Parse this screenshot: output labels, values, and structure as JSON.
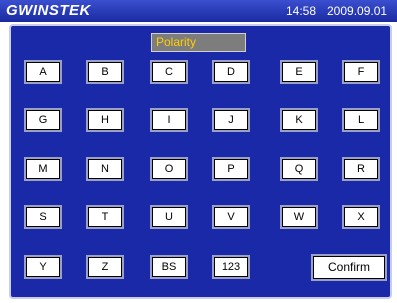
{
  "header": {
    "logo": "GWINSTEK",
    "time": "14:58",
    "date": "2009.09.01"
  },
  "input": {
    "value": "Polarity"
  },
  "keys": [
    "A",
    "B",
    "C",
    "D",
    "E",
    "F",
    "G",
    "H",
    "I",
    "J",
    "K",
    "L",
    "M",
    "N",
    "O",
    "P",
    "Q",
    "R",
    "S",
    "T",
    "U",
    "V",
    "W",
    "X",
    "Y",
    "Z",
    "BS",
    "123"
  ],
  "confirm_label": "Confirm",
  "colors": {
    "panel": "#1a29a8",
    "input_text": "#ffd000"
  }
}
